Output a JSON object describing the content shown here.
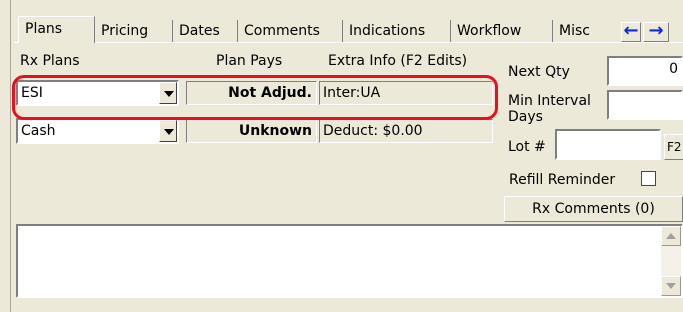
{
  "tabs": [
    {
      "label": "Plans",
      "active": true
    },
    {
      "label": "Pricing",
      "active": false
    },
    {
      "label": "Dates",
      "active": false
    },
    {
      "label": "Comments",
      "active": false
    },
    {
      "label": "Indications",
      "active": false
    },
    {
      "label": "Workflow",
      "active": false
    },
    {
      "label": "Misc",
      "active": false
    }
  ],
  "nav_arrows": {
    "left_icon": "arrow-left-icon",
    "right_icon": "arrow-right-icon",
    "color": "#0a2be0"
  },
  "plans_table": {
    "headers": {
      "rx_plans": "Rx Plans",
      "plan_pays": "Plan Pays",
      "extra_info": "Extra Info (F2 Edits)"
    },
    "rows": [
      {
        "plan": "ESI",
        "plan_pays": "Not Adjud.",
        "extra_info": "Inter:UA",
        "highlighted": true
      },
      {
        "plan": "Cash",
        "plan_pays": "Unknown",
        "extra_info": "Deduct: $0.00",
        "highlighted": false
      }
    ]
  },
  "highlight_color": "#e8101a",
  "side_fields": {
    "next_qty_label": "Next Qty",
    "next_qty_value": "0",
    "min_interval_label": "Min Interval",
    "days_label": "Days",
    "min_interval_value": "",
    "lot_label": "Lot #",
    "lot_value": "",
    "f2_button": "F2",
    "refill_reminder_label": "Refill Reminder",
    "refill_reminder_checked": false,
    "rx_comments_button": "Rx Comments (0)"
  },
  "comments_memo": {
    "value": ""
  }
}
